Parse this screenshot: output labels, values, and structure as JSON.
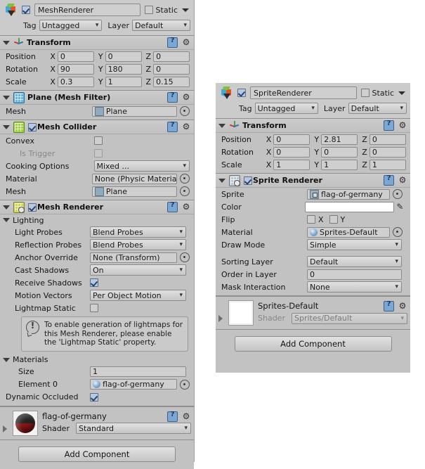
{
  "left": {
    "header": {
      "active": true,
      "name": "MeshRenderer",
      "static_label": "Static",
      "static_checked": false,
      "tag_label": "Tag",
      "tag_value": "Untagged",
      "layer_label": "Layer",
      "layer_value": "Default"
    },
    "transform": {
      "title": "Transform",
      "rows": [
        {
          "label": "Position",
          "x": "0",
          "y": "0",
          "z": "0"
        },
        {
          "label": "Rotation",
          "x": "90",
          "y": "180",
          "z": "0"
        },
        {
          "label": "Scale",
          "x": "0.3",
          "y": "1",
          "z": "0.15"
        }
      ],
      "axis_x": "X",
      "axis_y": "Y",
      "axis_z": "Z"
    },
    "mesh_filter": {
      "title": "Plane (Mesh Filter)",
      "mesh_label": "Mesh",
      "mesh_value": "Plane"
    },
    "mesh_collider": {
      "title": "Mesh Collider",
      "enabled": true,
      "convex_label": "Convex",
      "convex_checked": false,
      "is_trigger_label": "Is Trigger",
      "is_trigger_checked": false,
      "cooking_label": "Cooking Options",
      "cooking_value": "Mixed ...",
      "material_label": "Material",
      "material_value": "None (Physic Materia",
      "mesh_label": "Mesh",
      "mesh_value": "Plane"
    },
    "mesh_renderer": {
      "title": "Mesh Renderer",
      "enabled": true,
      "lighting_label": "Lighting",
      "rows": [
        {
          "label": "Light Probes",
          "value": "Blend Probes",
          "kind": "popup"
        },
        {
          "label": "Reflection Probes",
          "value": "Blend Probes",
          "kind": "popup"
        },
        {
          "label": "Anchor Override",
          "value": "None (Transform)",
          "kind": "object"
        },
        {
          "label": "Cast Shadows",
          "value": "On",
          "kind": "popup"
        },
        {
          "label": "Receive Shadows",
          "value": "",
          "kind": "checkbox",
          "checked": true
        },
        {
          "label": "Motion Vectors",
          "value": "Per Object Motion",
          "kind": "popup"
        },
        {
          "label": "Lightmap Static",
          "value": "",
          "kind": "checkbox",
          "checked": false
        }
      ],
      "info": "To enable generation of lightmaps for this Mesh Renderer, please enable the 'Lightmap Static' property.",
      "materials_label": "Materials",
      "size_label": "Size",
      "size_value": "1",
      "element_label": "Element 0",
      "element_value": "flag-of-germany",
      "dynamic_occluded_label": "Dynamic Occluded",
      "dynamic_occluded_checked": true
    },
    "material_editor": {
      "name": "flag-of-germany",
      "shader_label": "Shader",
      "shader_value": "Standard"
    },
    "add_component": "Add Component"
  },
  "right": {
    "header": {
      "active": true,
      "name": "SpriteRenderer",
      "static_label": "Static",
      "static_checked": false,
      "tag_label": "Tag",
      "tag_value": "Untagged",
      "layer_label": "Layer",
      "layer_value": "Default"
    },
    "transform": {
      "title": "Transform",
      "rows": [
        {
          "label": "Position",
          "x": "0",
          "y": "2.81",
          "z": "0"
        },
        {
          "label": "Rotation",
          "x": "0",
          "y": "0",
          "z": "0"
        },
        {
          "label": "Scale",
          "x": "1",
          "y": "1",
          "z": "1"
        }
      ],
      "axis_x": "X",
      "axis_y": "Y",
      "axis_z": "Z"
    },
    "sprite_renderer": {
      "title": "Sprite Renderer",
      "enabled": true,
      "sprite_label": "Sprite",
      "sprite_value": "flag-of-germany",
      "color_label": "Color",
      "color_value": "#FFFFFF",
      "flip_label": "Flip",
      "flip_x_label": "X",
      "flip_x_checked": false,
      "flip_y_label": "Y",
      "flip_y_checked": false,
      "material_label": "Material",
      "material_value": "Sprites-Default",
      "draw_mode_label": "Draw Mode",
      "draw_mode_value": "Simple",
      "sorting_layer_label": "Sorting Layer",
      "sorting_layer_value": "Default",
      "order_in_layer_label": "Order in Layer",
      "order_in_layer_value": "0",
      "mask_interaction_label": "Mask Interaction",
      "mask_interaction_value": "None"
    },
    "material_editor": {
      "name": "Sprites-Default",
      "shader_label": "Shader",
      "shader_value": "Sprites/Default"
    },
    "add_component": "Add Component"
  }
}
